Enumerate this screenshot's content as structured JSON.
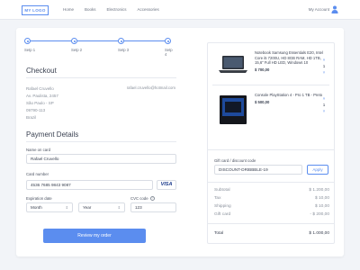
{
  "nav": {
    "logo": "MY LOGO",
    "menu": [
      "Home",
      "Books",
      "Electronics",
      "Accessories"
    ],
    "account": "My Account"
  },
  "steps": [
    "Setp 1",
    "Setp 2",
    "Setp 3",
    "Setp 4"
  ],
  "checkout": {
    "title": "Checkout",
    "address": [
      "Rafael Cruvello",
      "Av. Paulista, 2457",
      "São Paulo - SP",
      "09790-113",
      "Brazil"
    ],
    "email": "rafael.cruvello@hotmail.com"
  },
  "payment": {
    "title": "Payment Details",
    "name_label": "Name on card",
    "name_value": "Rafael Cruvello",
    "card_label": "Card number",
    "card_value": "4536 7685 9843 9087",
    "card_brand": "VISA",
    "exp_label": "Expiration date",
    "month": "Month",
    "year": "Year",
    "cvc_label": "CVC code",
    "cvc_info": "?",
    "cvc_value": "123",
    "submit": "Review my order"
  },
  "products": [
    {
      "title": "Notebook Samsung Essentials E20, Intel Core i5 7200U, HD 8GB RAM, HD 1TB, 15,6\" Full HD LED, Windows 10",
      "price": "$ 700,00",
      "qty": "1"
    },
    {
      "title": "Console PlayStation 4 - Pro 1 TB - Preto",
      "price": "$ 500,00",
      "qty": "1"
    }
  ],
  "gift": {
    "label": "Gift card / discount code",
    "value": "DISCOUNT-DRIBBBLE-19",
    "apply": "Apply"
  },
  "totals": [
    {
      "label": "Subtotal",
      "value": "$ 1.200,00"
    },
    {
      "label": "Tax",
      "value": "$ 10,00"
    },
    {
      "label": "Shipping",
      "value": "$ 10,00"
    },
    {
      "label": "Gift card",
      "value": "- $ 200,00"
    }
  ],
  "total": {
    "label": "Total",
    "value": "$ 1.000,00"
  },
  "colors": {
    "accent": "#5b8def",
    "background": "#f2f4f8",
    "visa": "#1a3a8c"
  }
}
